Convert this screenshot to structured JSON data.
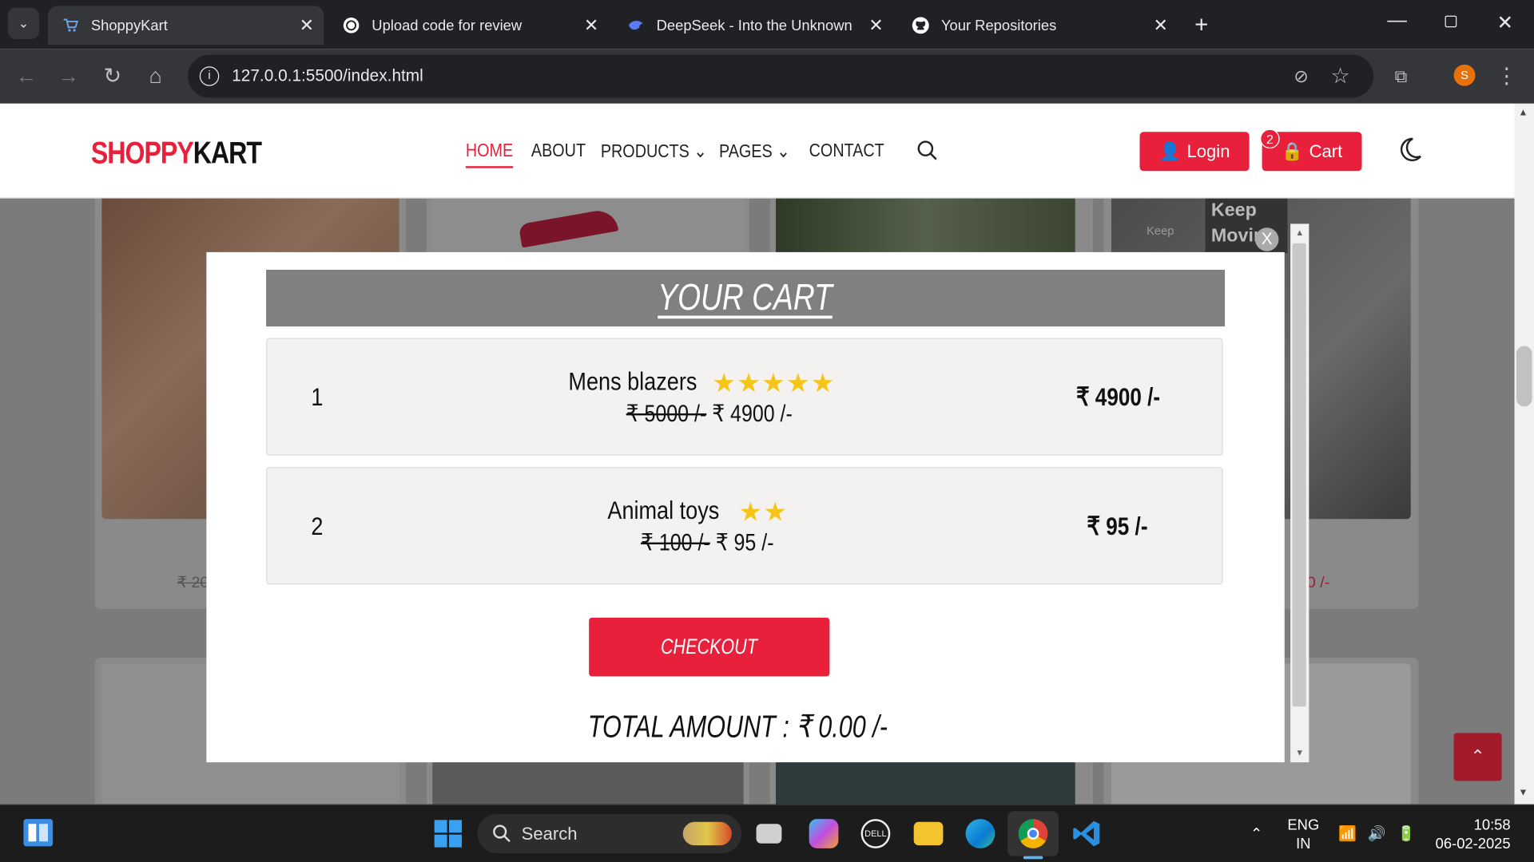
{
  "browser": {
    "tabs": [
      {
        "title": "ShoppyKart",
        "active": true
      },
      {
        "title": "Upload code for review",
        "active": false
      },
      {
        "title": "DeepSeek - Into the Unknown",
        "active": false
      },
      {
        "title": "Your Repositories",
        "active": false
      }
    ],
    "url": "127.0.0.1:5500/index.html",
    "profile_initial": "S"
  },
  "site": {
    "logo_a": "SHOPPY",
    "logo_b": "KART",
    "nav": {
      "home": "HOME",
      "about": "ABOUT",
      "products": "PRODUCTS",
      "pages": "PAGES",
      "contact": "CONTACT"
    },
    "login_label": "Login",
    "cart_label": "Cart",
    "cart_count": "2"
  },
  "background": {
    "price_left": "₹ 20",
    "price_right": "0 /-",
    "poster_text": "Keep Movin",
    "poster_small": "Keep"
  },
  "cart": {
    "heading": "YOUR CART",
    "items": [
      {
        "index": "1",
        "name": "Mens blazers",
        "stars": "★★★★★",
        "rating": 5,
        "old_price": "₹ 5000 /-",
        "price": "₹ 4900 /-",
        "total": "₹ 4900 /-"
      },
      {
        "index": "2",
        "name": "Animal toys",
        "stars": "★★",
        "rating": 2,
        "old_price": "₹ 100 /-",
        "price": "₹ 95 /-",
        "total": "₹ 95 /-"
      }
    ],
    "checkout_label": "CHECKOUT",
    "total_label": "TOTAL AMOUNT : ₹ 0.00 /-",
    "close_label": "X"
  },
  "taskbar": {
    "search_label": "Search",
    "lang_top": "ENG",
    "lang_bottom": "IN",
    "time": "10:58",
    "date": "06-02-2025"
  },
  "colors": {
    "brand_red": "#e8203b",
    "star": "#f5c518",
    "cart_header": "#808080"
  }
}
